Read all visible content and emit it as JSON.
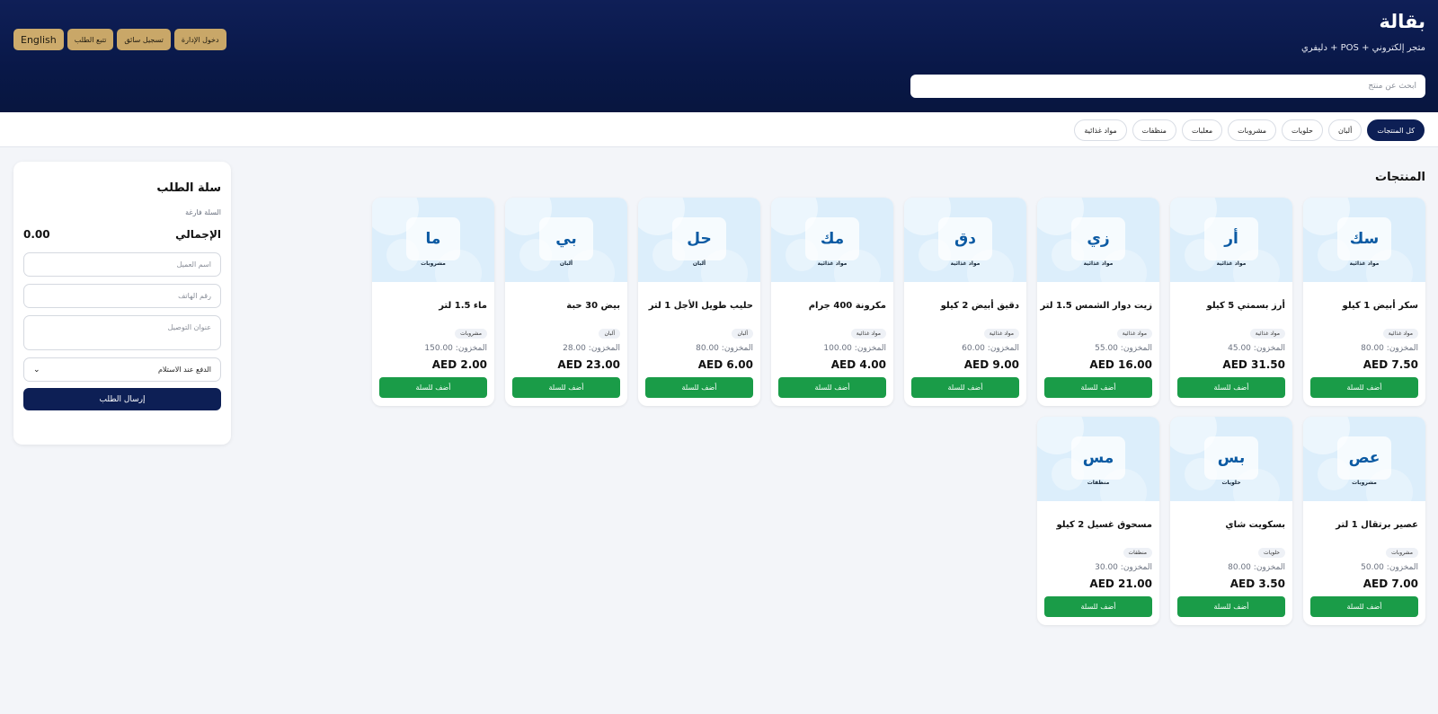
{
  "header": {
    "title": "بقالة",
    "subtitle": "متجر إلكتروني + POS + دليفري",
    "search_placeholder": "ابحث عن منتج",
    "buttons": {
      "english": "English",
      "track_order": "تتبع الطلب",
      "driver_register": "تسجيل سائق",
      "admin_login": "دخول الإدارة"
    }
  },
  "categories": [
    "كل المنتجات",
    "ألبان",
    "حلويات",
    "مشروبات",
    "معلبات",
    "منظفات",
    "مواد غذائية"
  ],
  "products_section_title": "المنتجات",
  "stock_label": "المخزون:",
  "add_button_label": "أضف للسلة",
  "products": [
    {
      "abbr": "سك",
      "category": "مواد غذائية",
      "name": "سكر أبيض 1 كيلو",
      "stock": "80.00",
      "price": "AED 7.50"
    },
    {
      "abbr": "أر",
      "category": "مواد غذائية",
      "name": "أرز بسمتي 5 كيلو",
      "stock": "45.00",
      "price": "AED 31.50"
    },
    {
      "abbr": "زي",
      "category": "مواد غذائية",
      "name": "زيت دوار الشمس 1.5 لتر",
      "stock": "55.00",
      "price": "AED 16.00"
    },
    {
      "abbr": "دق",
      "category": "مواد غذائية",
      "name": "دقيق أبيض 2 كيلو",
      "stock": "60.00",
      "price": "AED 9.00"
    },
    {
      "abbr": "مك",
      "category": "مواد غذائية",
      "name": "مكرونة 400 جرام",
      "stock": "100.00",
      "price": "AED 4.00"
    },
    {
      "abbr": "حل",
      "category": "ألبان",
      "name": "حليب طويل الأجل 1 لتر",
      "stock": "80.00",
      "price": "AED 6.00"
    },
    {
      "abbr": "بي",
      "category": "ألبان",
      "name": "بيض 30 حبة",
      "stock": "28.00",
      "price": "AED 23.00"
    },
    {
      "abbr": "ما",
      "category": "مشروبات",
      "name": "ماء 1.5 لتر",
      "stock": "150.00",
      "price": "AED 2.00"
    },
    {
      "abbr": "عص",
      "category": "مشروبات",
      "name": "عصير برتقال 1 لتر",
      "stock": "50.00",
      "price": "AED 7.00"
    },
    {
      "abbr": "بس",
      "category": "حلويات",
      "name": "بسكويت شاي",
      "stock": "80.00",
      "price": "AED 3.50"
    },
    {
      "abbr": "مس",
      "category": "منظفات",
      "name": "مسحوق غسيل 2 كيلو",
      "stock": "30.00",
      "price": "AED 21.00"
    }
  ],
  "cart": {
    "title": "سلة الطلب",
    "empty_text": "السلة فارغة",
    "total_label": "الإجمالي",
    "total_value": "0.00",
    "name_placeholder": "اسم العميل",
    "phone_placeholder": "رقم الهاتف",
    "address_placeholder": "عنوان التوصيل",
    "payment_selected": "الدفع عند الاستلام",
    "submit_label": "إرسال الطلب"
  },
  "colors": {
    "header_bg": "#0b1a4e",
    "gold_button": "#c9a768",
    "primary": "#0d1f55",
    "add_button": "#1a9c48",
    "card_top": "#dceefb"
  }
}
